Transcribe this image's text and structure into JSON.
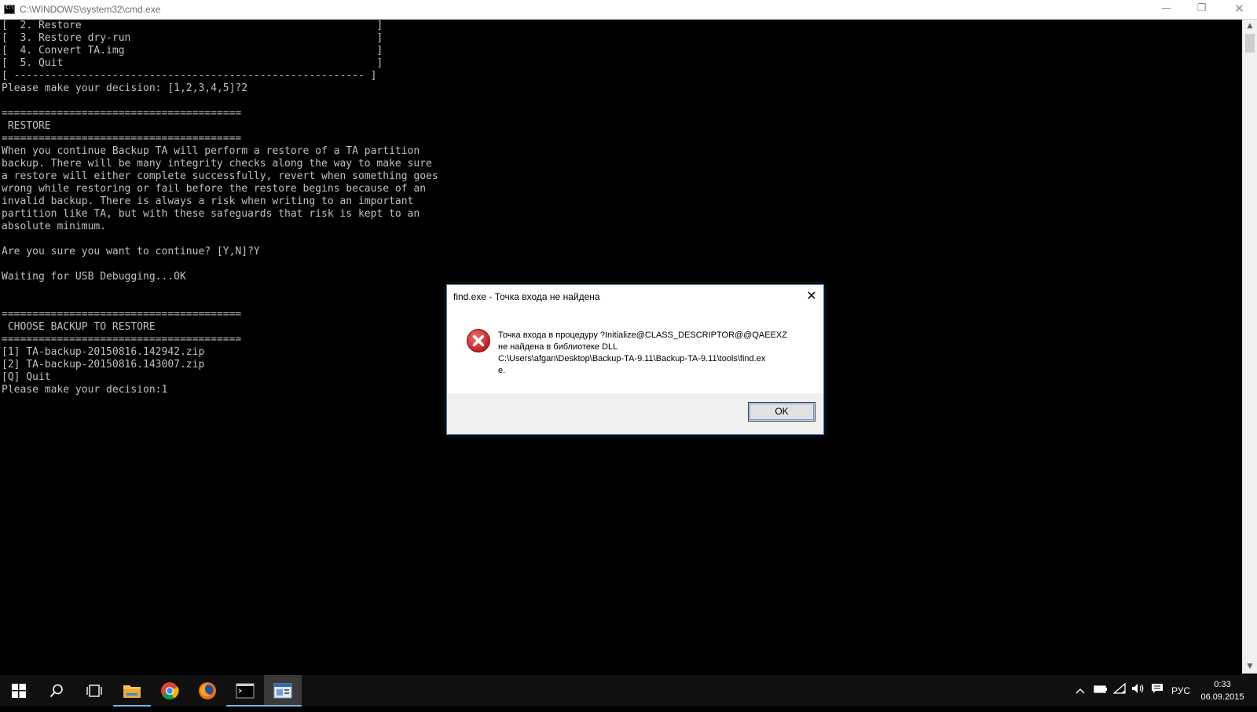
{
  "window": {
    "title": "C:\\WINDOWS\\system32\\cmd.exe",
    "minimize_symbol": "—",
    "maximize_symbol": "❐",
    "close_symbol": "✕"
  },
  "console": {
    "lines": [
      "[  2. Restore                                                ]",
      "[  3. Restore dry-run                                        ]",
      "[  4. Convert TA.img                                         ]",
      "[  5. Quit                                                   ]",
      "[ --------------------------------------------------------- ]",
      "Please make your decision: [1,2,3,4,5]?2",
      "",
      "=======================================",
      " RESTORE",
      "=======================================",
      "When you continue Backup TA will perform a restore of a TA partition",
      "backup. There will be many integrity checks along the way to make sure",
      "a restore will either complete successfully, revert when something goes",
      "wrong while restoring or fail before the restore begins because of an",
      "invalid backup. There is always a risk when writing to an important",
      "partition like TA, but with these safeguards that risk is kept to an",
      "absolute minimum.",
      "",
      "Are you sure you want to continue? [Y,N]?Y",
      "",
      "Waiting for USB Debugging...OK",
      "",
      "",
      "=======================================",
      " CHOOSE BACKUP TO RESTORE",
      "=======================================",
      "[1] TA-backup-20150816.142942.zip",
      "[2] TA-backup-20150816.143007.zip",
      "[Q] Quit",
      "Please make your decision:1"
    ]
  },
  "dialog": {
    "title": "find.exe - Точка входа не найдена",
    "message": "Точка входа в процедуру ?Initialize@CLASS_DESCRIPTOR@@QAEEXZ\nне найдена в библиотеке DLL\nC:\\Users\\afgan\\Desktop\\Backup-TA-9.11\\Backup-TA-9.11\\tools\\find.ex\ne.",
    "ok_label": "OK",
    "close_symbol": "✕",
    "icon": "error-icon"
  },
  "taskbar": {
    "items": [
      "windows-start",
      "search",
      "task-view",
      "file-explorer",
      "chrome",
      "firefox",
      "cmd",
      "app"
    ],
    "language": "РУС",
    "time": "0:33",
    "date": "06.09.2015",
    "accent_color": "#76b9ed"
  }
}
